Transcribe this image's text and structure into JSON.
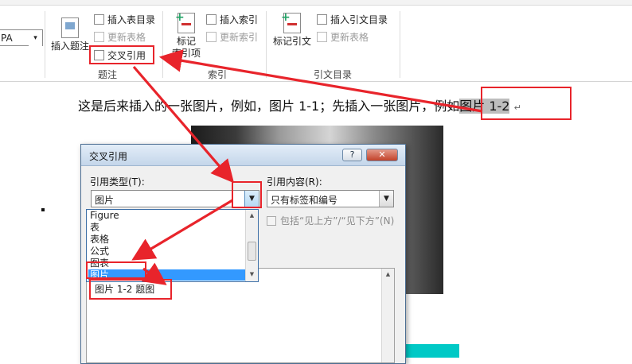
{
  "ribbon": {
    "style_box": {
      "value": "PA"
    },
    "captions": {
      "insert_caption": "插入题注",
      "insert_table_of_figures": "插入表目录",
      "update_table": "更新表格",
      "cross_reference": "交叉引用",
      "group": "题注"
    },
    "index": {
      "mark_entry": "标记\n索引项",
      "insert_index": "插入索引",
      "update_index": "更新索引",
      "group": "索引"
    },
    "citations": {
      "mark_citation": "标记引文",
      "insert_table_of_authorities": "插入引文目录",
      "update_table": "更新表格",
      "group": "引文目录"
    }
  },
  "document": {
    "body_text": "这是后来插入的一张图片，例如，图片 1-1；先插入一张图片，例如",
    "field_text": "图片 1-2",
    "paragraph_mark": "↵"
  },
  "dialog": {
    "title": "交叉引用",
    "help_button": "?",
    "close_button": "✕",
    "reference_type_label": "引用类型(T):",
    "reference_type_value": "图片",
    "insert_reference_label": "引用内容(R):",
    "insert_reference_value": "只有标签和编号",
    "include_above_below_label": "包括“见上方”/“见下方”(N)",
    "dropdown_options": [
      "Figure",
      "表",
      "表格",
      "公式",
      "图表",
      "图片"
    ],
    "selected_option": "图片",
    "caption_list": [
      "图片 1-2 题图"
    ]
  },
  "colors": {
    "annotation_red": "#e8242b",
    "selection_blue": "#3399ff",
    "teal": "#00c9c6"
  }
}
